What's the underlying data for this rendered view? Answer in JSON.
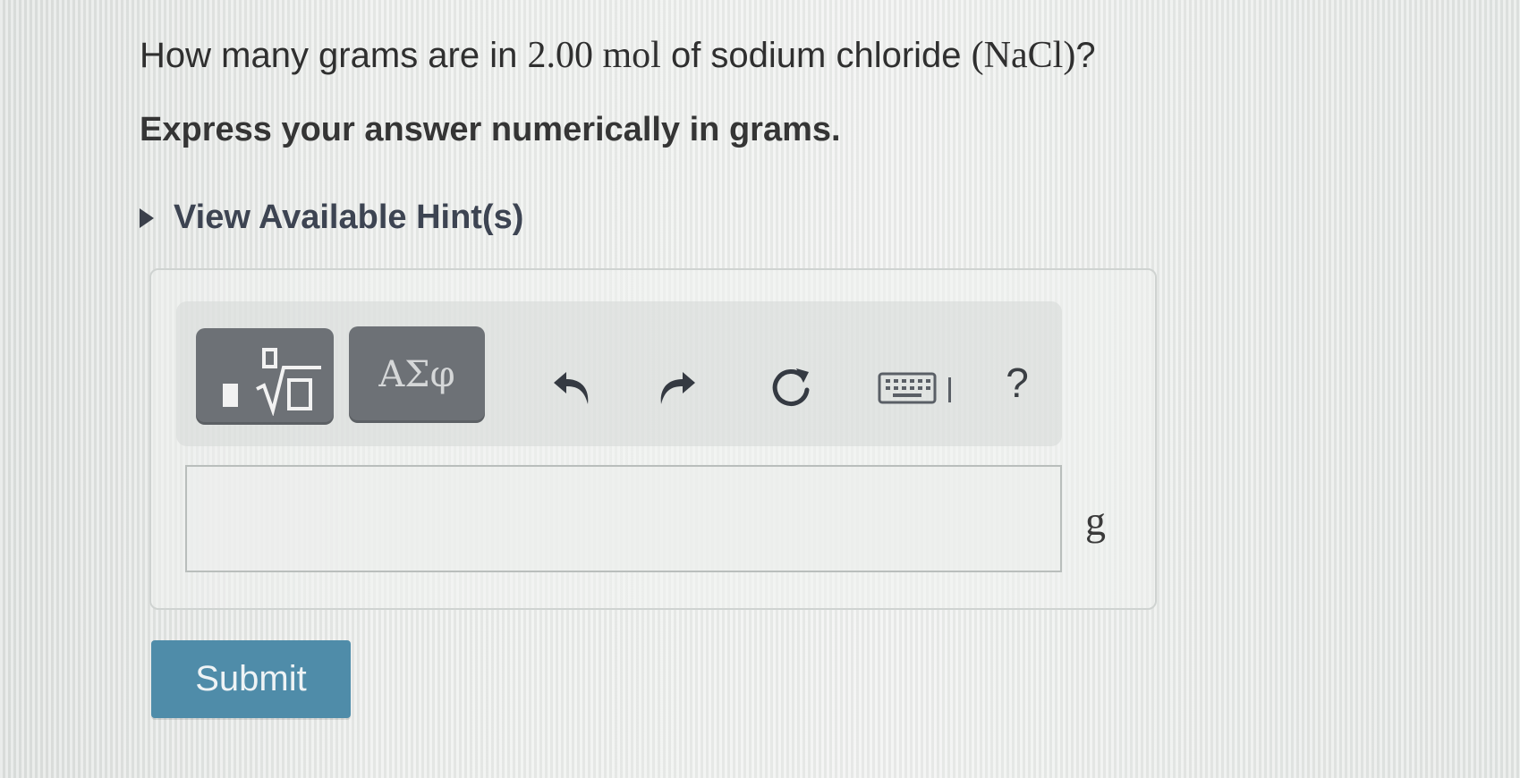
{
  "question": {
    "text_before": "How many grams are in ",
    "quantity": "2.00 mol",
    "text_middle": " of sodium chloride ",
    "formula": "(NaCl)",
    "text_after": "?"
  },
  "instruction": "Express your answer numerically in grams.",
  "hints": {
    "label": "View Available Hint(s)"
  },
  "toolbar": {
    "greek_label": "ΑΣφ",
    "help_label": "?",
    "icons": [
      "templates-icon",
      "undo-icon",
      "redo-icon",
      "reset-icon",
      "keyboard-icon",
      "help-icon"
    ]
  },
  "answer": {
    "value": "",
    "unit": "g"
  },
  "submit_label": "Submit",
  "colors": {
    "submit_button": "#4f8ca9",
    "toolbar_button": "#6d7176",
    "hint_text": "#3d4452"
  }
}
